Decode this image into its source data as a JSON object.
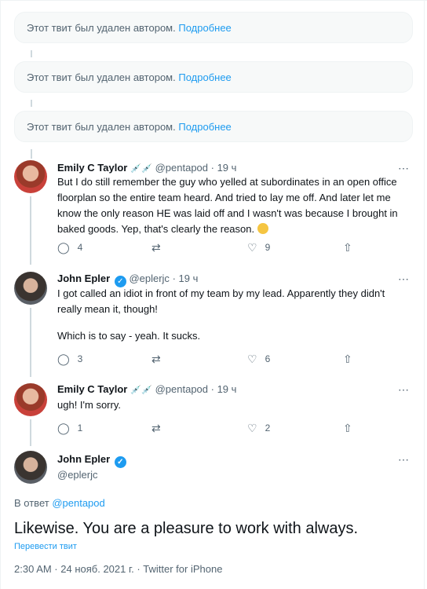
{
  "deleted_notice": {
    "text": "Этот твит был удален автором.",
    "link": "Подробнее"
  },
  "replies": [
    {
      "name": "Emily C Taylor",
      "badges": "💉💉",
      "handle": "@pentapod",
      "time": "· 19 ч",
      "text": "But I do still remember the guy who yelled at subordinates in an open office floorplan so the entire team heard. And tried to lay me off. And later let me know the only reason HE was laid off and I wasn't was because I brought in baked goods. Yep, that's clearly the reason.",
      "reply_count": "4",
      "like_count": "9"
    },
    {
      "name": "John Epler",
      "handle": "@eplerjc",
      "time": "· 19 ч",
      "text": "I got called an idiot in front of my team by my lead. Apparently they didn't really mean it, though!",
      "text2": "Which is to say - yeah. It sucks.",
      "reply_count": "3",
      "like_count": "6"
    },
    {
      "name": "Emily C Taylor",
      "badges": "💉💉",
      "handle": "@pentapod",
      "time": "· 19 ч",
      "text": "ugh! I'm sorry.",
      "reply_count": "1",
      "like_count": "2"
    }
  ],
  "main_tweet": {
    "name": "John Epler",
    "handle": "@eplerjc",
    "reply_prefix": "В ответ",
    "reply_mention": "@pentapod",
    "text": "Likewise. You are a pleasure to work with always.",
    "translate": "Перевести твит",
    "meta": "2:30 AM · 24 нояб. 2021 г. · Twitter for iPhone"
  },
  "icons": {
    "more": "⋯",
    "reply": "reply-icon",
    "retweet": "retweet-icon",
    "like": "heart-icon",
    "share": "share-icon"
  },
  "colors": {
    "accent": "#1d9bf0",
    "secondary_text": "#536471",
    "primary_text": "#0f1419"
  }
}
